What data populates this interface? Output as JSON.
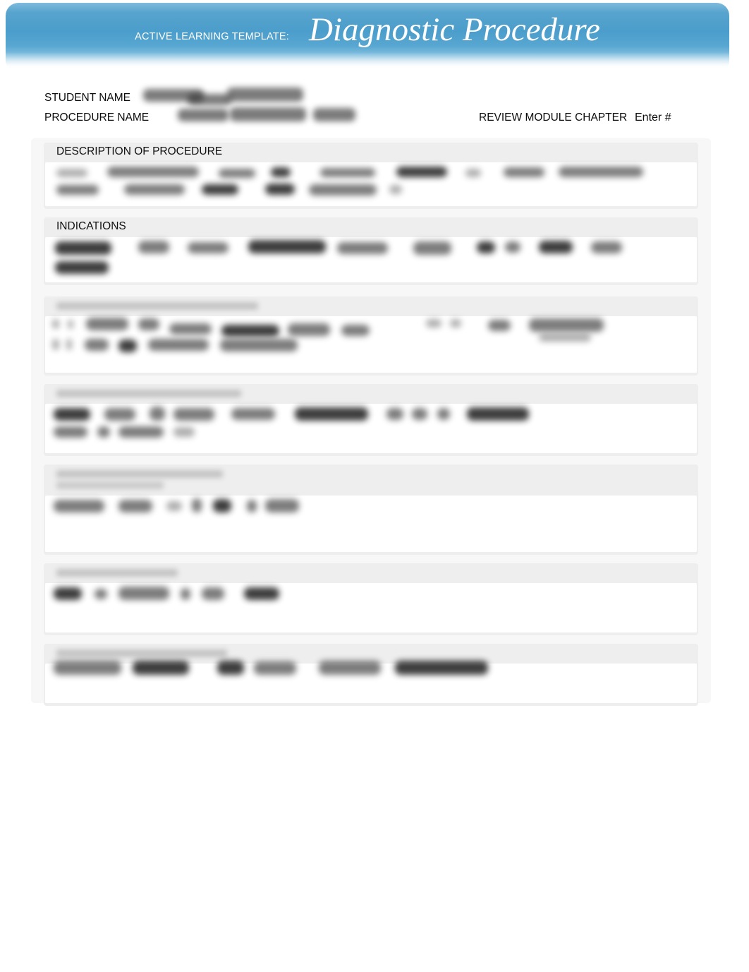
{
  "banner": {
    "eyebrow": "ACTIVE LEARNING TEMPLATE:",
    "title": "Diagnostic Procedure",
    "color_start": "#7fbbdd",
    "color_mid": "#4b9dcb",
    "color_end": "#ffffff",
    "text_color": "#ffffff"
  },
  "meta": {
    "student_name_label": "STUDENT NAME",
    "student_name_value": "",
    "procedure_name_label": "PROCEDURE NAME",
    "procedure_name_value": "",
    "review_module_label": "REVIEW MODULE CHAPTER",
    "review_module_value": "Enter #"
  },
  "sections": [
    {
      "id": "description-of-procedure",
      "title": "DESCRIPTION OF PROCEDURE",
      "title_visible": true,
      "body_text": ""
    },
    {
      "id": "indications",
      "title": "INDICATIONS",
      "title_visible": true,
      "body_text": ""
    },
    {
      "id": "section-3",
      "title": "",
      "title_visible": false,
      "body_text": ""
    },
    {
      "id": "section-4",
      "title": "",
      "title_visible": false,
      "body_text": ""
    },
    {
      "id": "section-5",
      "title": "",
      "title_visible": false,
      "body_text": ""
    },
    {
      "id": "section-6",
      "title": "",
      "title_visible": false,
      "body_text": ""
    },
    {
      "id": "section-7",
      "title": "",
      "title_visible": false,
      "body_text": ""
    }
  ],
  "colors": {
    "sheet_background": "#f7f7f7",
    "panel_header_background": "#eeeeee",
    "panel_body_background": "#ffffff",
    "page_background": "#ffffff",
    "label_text": "#0c0c0c"
  }
}
